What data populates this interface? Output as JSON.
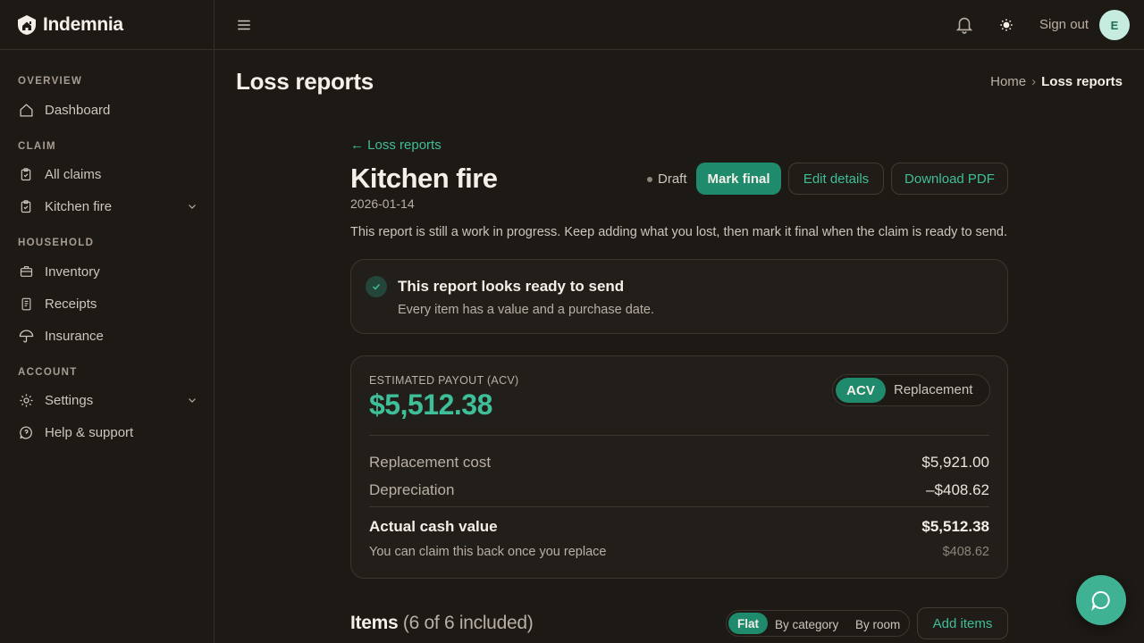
{
  "app": {
    "name": "Indemnia"
  },
  "sidebar": {
    "sections": [
      {
        "title": "OVERVIEW",
        "items": [
          {
            "label": "Dashboard",
            "icon": "home-icon"
          }
        ]
      },
      {
        "title": "CLAIM",
        "items": [
          {
            "label": "All claims",
            "icon": "clipboard-icon"
          },
          {
            "label": "Kitchen fire",
            "icon": "clipboard-icon",
            "expandable": true
          }
        ]
      },
      {
        "title": "HOUSEHOLD",
        "items": [
          {
            "label": "Inventory",
            "icon": "briefcase-icon"
          },
          {
            "label": "Receipts",
            "icon": "receipt-icon"
          },
          {
            "label": "Insurance",
            "icon": "umbrella-icon"
          }
        ]
      },
      {
        "title": "ACCOUNT",
        "items": [
          {
            "label": "Settings",
            "icon": "gear-icon",
            "expandable": true
          },
          {
            "label": "Help & support",
            "icon": "help-chat-icon"
          }
        ]
      }
    ]
  },
  "topbar": {
    "sign_out": "Sign out",
    "avatar_initial": "E"
  },
  "page": {
    "title": "Loss reports",
    "breadcrumb": {
      "home": "Home",
      "sep": "›",
      "current": "Loss reports"
    }
  },
  "report": {
    "back_link": "← Loss reports",
    "title": "Kitchen fire",
    "date": "2026-01-14",
    "description": "This report is still a work in progress. Keep adding what you lost, then mark it final when the claim is ready to send.",
    "status": "Draft",
    "actions": {
      "mark_final": "Mark final",
      "edit_details": "Edit details",
      "download_pdf": "Download PDF"
    }
  },
  "ready": {
    "title": "This report looks ready to send",
    "subtitle": "Every item has a value and a purchase date."
  },
  "payout": {
    "label": "ESTIMATED PAYOUT (ACV)",
    "value": "$5,512.38",
    "toggle": {
      "acv": "ACV",
      "replacement": "Replacement"
    },
    "rows": {
      "replacement_cost": {
        "label": "Replacement cost",
        "value": "$5,921.00"
      },
      "depreciation": {
        "label": "Depreciation",
        "value": "–$408.62"
      },
      "acv": {
        "label": "Actual cash value",
        "value": "$5,512.38"
      },
      "claim_back": {
        "label": "You can claim this back once you replace",
        "value": "$408.62"
      }
    }
  },
  "items": {
    "title": "Items",
    "count": "(6 of 6 included)",
    "views": {
      "flat": "Flat",
      "by_category": "By category",
      "by_room": "By room"
    },
    "add": "Add items"
  },
  "colors": {
    "accent": "#3fbf99",
    "primary_button": "#1f8a6c",
    "background": "#1d1915"
  }
}
